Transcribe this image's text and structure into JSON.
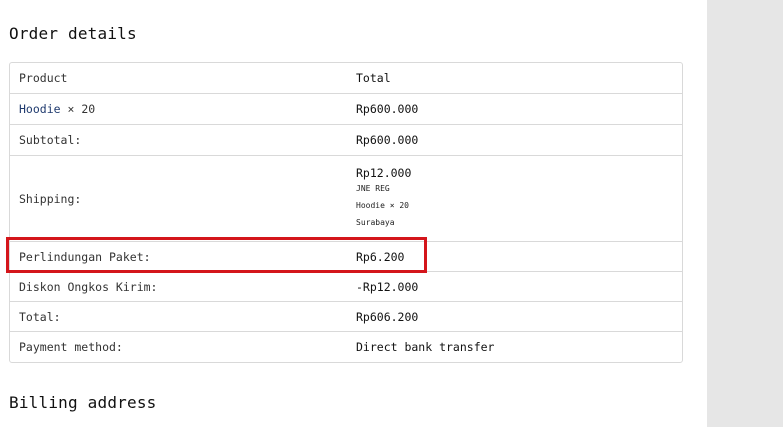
{
  "order_details": {
    "title": "Order details",
    "header": {
      "product": "Product",
      "total": "Total"
    },
    "item": {
      "name": "Hoodie",
      "qty": "× 20",
      "total": "Rp600.000"
    },
    "subtotal": {
      "label": "Subtotal:",
      "value": "Rp600.000"
    },
    "shipping": {
      "label": "Shipping:",
      "amount": "Rp12.000",
      "service": "JNE REG",
      "items": "Hoodie × 20",
      "destination": "Surabaya"
    },
    "protection": {
      "label": "Perlindungan Paket:",
      "value": "Rp6.200"
    },
    "discount": {
      "label": "Diskon Ongkos Kirim:",
      "value": "-Rp12.000"
    },
    "total": {
      "label": "Total:",
      "value": "Rp606.200"
    },
    "payment": {
      "label": "Payment method:",
      "value": "Direct bank transfer"
    }
  },
  "billing": {
    "title": "Billing address"
  },
  "colors": {
    "highlight": "#d4151b",
    "link": "#1f3a6e",
    "border": "#d9d9d9",
    "sidebar": "#e6e6e6"
  }
}
